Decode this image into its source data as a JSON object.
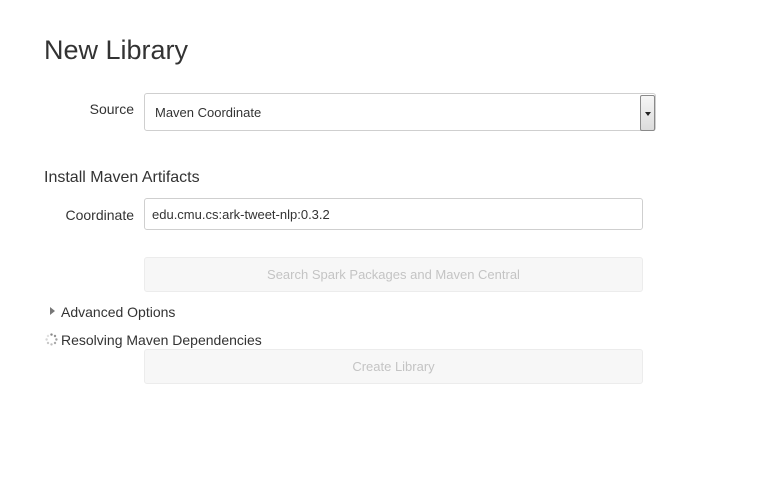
{
  "page": {
    "title": "New Library"
  },
  "source": {
    "label": "Source",
    "selected": "Maven Coordinate"
  },
  "maven": {
    "section_title": "Install Maven Artifacts",
    "coordinate_label": "Coordinate",
    "coordinate_value": "edu.cmu.cs:ark-tweet-nlp:0.3.2",
    "search_button": "Search Spark Packages and Maven Central"
  },
  "advanced": {
    "label": "Advanced Options"
  },
  "status": {
    "resolving": "Resolving Maven Dependencies"
  },
  "actions": {
    "create_button": "Create Library"
  },
  "icons": {
    "expand": "caret-right-icon",
    "loading": "spinner-icon"
  }
}
